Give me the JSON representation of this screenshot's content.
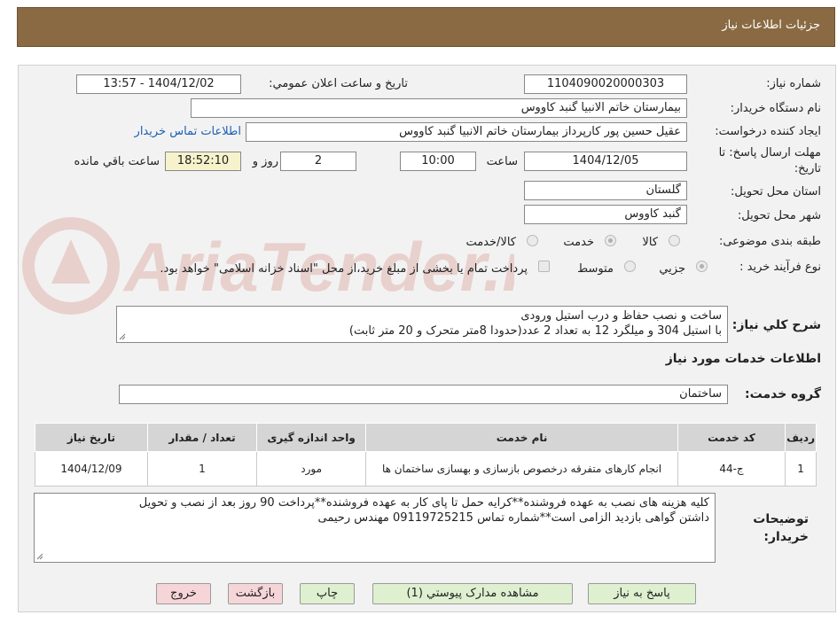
{
  "header": {
    "title": "جزئیات اطلاعات نیاز"
  },
  "fields": {
    "need_number_label": "شماره نیاز:",
    "need_number": "1104090020000303",
    "announce_label": "تاریخ و ساعت اعلان عمومي:",
    "announce_value": "1404/12/02 - 13:57",
    "buyer_label": "نام دستگاه خريدار:",
    "buyer_value": "بیمارستان خاتم الانبیا گنبد کاووس",
    "requester_label": "ایجاد کننده درخواست:",
    "requester_value": "عقیل حسین پور کارپرداز بیمارستان خاتم الانبیا گنبد کاووس",
    "contact_link": "اطلاعات تماس خریدار",
    "deadline_label": "مهلت ارسال پاسخ: تا تاریخ:",
    "deadline_date": "1404/12/05",
    "hour_label": "ساعت",
    "deadline_time": "10:00",
    "days_value": "2",
    "days_label": "روز و",
    "remaining_time": "18:52:10",
    "remaining_label": "ساعت باقي مانده",
    "province_label": "استان محل تحویل:",
    "province_value": "گلستان",
    "city_label": "شهر محل تحویل:",
    "city_value": "گنبد کاووس",
    "category_label": "طبقه بندی موضوعی:",
    "category_options": [
      "کالا",
      "خدمت",
      "کالا/خدمت"
    ],
    "process_label": "نوع فرآیند خرید :",
    "process_options": [
      "جزیي",
      "متوسط"
    ],
    "payment_note": "پرداخت تمام یا بخشی از مبلغ خرید،از محل \"اسناد خزانه اسلامی\" خواهد بود."
  },
  "description": {
    "label": "شرح کلي نیاز:",
    "line1": "ساخت و نصب حفاظ و درب استیل ورودی",
    "line2": "با استیل 304 و میلگرد 12 به تعداد 2 عدد(حدودا 8متر متحرک و 20 متر ثابت)"
  },
  "services": {
    "section_title": "اطلاعات خدمات مورد نیاز",
    "group_label": "گروه خدمت:",
    "group_value": "ساختمان",
    "columns": [
      "رديف",
      "کد خدمت",
      "نام خدمت",
      "واحد اندازه گیری",
      "تعداد / مقدار",
      "تاریخ نیاز"
    ],
    "rows": [
      [
        "1",
        "ج-44",
        "انجام کارهای متفرقه درخصوص بازسازی و بهسازی ساختمان ها",
        "مورد",
        "1",
        "1404/12/09"
      ]
    ]
  },
  "buyer_notes": {
    "label_line1": "توضیحات",
    "label_line2": "خریدار:",
    "line1": "کلیه هزینه های نصب به عهده فروشنده**کرایه حمل تا پای کار به عهده فروشنده**پرداخت 90 روز بعد از نصب و تحویل",
    "line2": "داشتن گواهی بازدید الزامی است**شماره تماس 09119725215 مهندس رحیمی"
  },
  "buttons": {
    "reply": "پاسخ به نیاز",
    "attachments": "مشاهده مدارک پیوستي (1)",
    "print": "چاپ",
    "back": "بازگشت",
    "exit": "خروج"
  },
  "watermark": {
    "text": "AriaTender.neT"
  },
  "colors": {
    "header_bg": "#8a6a43",
    "panel_bg": "#f2f2f2",
    "time_bg": "#f6f3cc",
    "btn_green": "#def0d0",
    "btn_pink": "#f6d5d8",
    "link": "#1a5fb4"
  }
}
